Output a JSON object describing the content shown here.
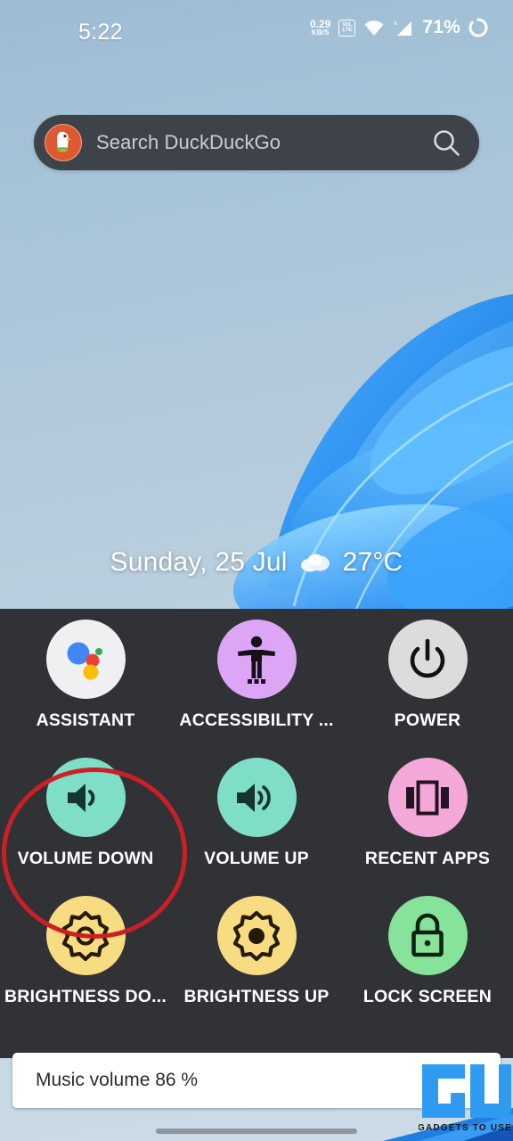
{
  "status_bar": {
    "clock": "5:22",
    "net_speed_value": "0.29",
    "net_speed_unit": "KB/S",
    "volte_top": "VoL",
    "volte_bottom": "LTE",
    "wifi_icon": "wifi-icon",
    "signal_icon": "cellular-signal-no-sim-icon",
    "battery_percent": "71%",
    "battery_icon": "battery-circle-icon"
  },
  "search": {
    "placeholder": "Search DuckDuckGo",
    "logo_icon": "duckduckgo-logo-icon",
    "search_icon": "search-icon",
    "bar_color": "#3d4349"
  },
  "widget": {
    "date": "Sunday, 25 Jul",
    "weather_icon": "cloud-icon",
    "temperature": "27°C"
  },
  "panel": {
    "background": "#303236",
    "rows": [
      [
        {
          "label": "ASSISTANT",
          "icon": "google-assistant-icon",
          "color": "#eef0f1"
        },
        {
          "label": "ACCESSIBILITY ...",
          "icon": "accessibility-person-icon",
          "color": "#dda5f5"
        },
        {
          "label": "POWER",
          "icon": "power-icon",
          "color": "#dcdcdc"
        }
      ],
      [
        {
          "label": "VOLUME DOWN",
          "icon": "volume-down-icon",
          "color": "#7fdec8"
        },
        {
          "label": "VOLUME UP",
          "icon": "volume-up-icon",
          "color": "#7fdec8"
        },
        {
          "label": "RECENT APPS",
          "icon": "recent-apps-icon",
          "color": "#f3a8d8"
        }
      ],
      [
        {
          "label": "BRIGHTNESS DO...",
          "icon": "brightness-down-icon",
          "color": "#f8dc81"
        },
        {
          "label": "BRIGHTNESS UP",
          "icon": "brightness-up-icon",
          "color": "#f8dc81"
        },
        {
          "label": "LOCK SCREEN",
          "icon": "lock-icon",
          "color": "#88e39a"
        }
      ]
    ]
  },
  "annotation": {
    "shape": "ellipse-highlight",
    "target": "VOLUME DOWN",
    "color": "#cc1f25"
  },
  "toast": {
    "message": "Music volume 86 %"
  },
  "watermark": {
    "text": "GADGETS TO USE",
    "logo_icon": "gu-logo-icon",
    "color": "#2f9bf0"
  },
  "nav": {
    "gesture_pill": "home-gesture-pill"
  }
}
